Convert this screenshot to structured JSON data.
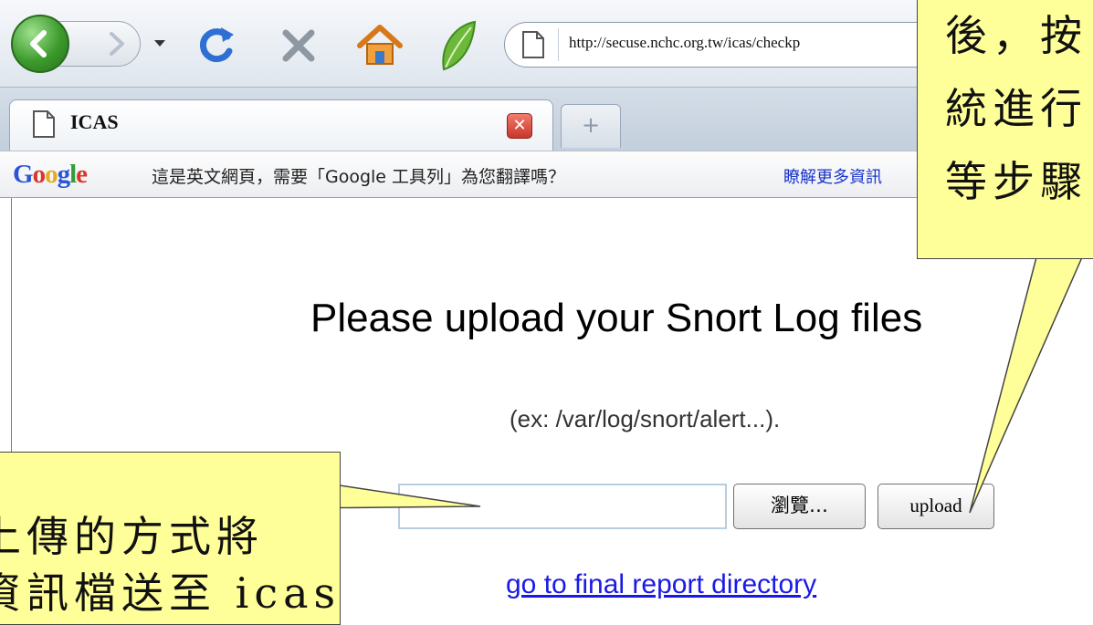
{
  "browser": {
    "url": "http://secuse.nchc.org.tw/icas/checkp",
    "tab_title": "ICAS",
    "tab_close_glyph": "✕",
    "new_tab_glyph": "+"
  },
  "translate_bar": {
    "logo_letters": [
      "G",
      "o",
      "o",
      "g",
      "l",
      "e"
    ],
    "logo_colors": [
      "#2a55d8",
      "#d8382a",
      "#e7a922",
      "#2a55d8",
      "#2f9e3a",
      "#d8382a"
    ],
    "message": "這是英文網頁，需要「Google 工具列」為您翻譯嗎？",
    "learn_more": "瞭解更多資訊"
  },
  "page": {
    "heading": "Please upload your Snort Log files",
    "example": "(ex: /var/log/snort/alert...).",
    "browse_label": "瀏覽…",
    "upload_label": "upload",
    "file_input_value": "",
    "final_report_link": "go to final report directory"
  },
  "callouts": {
    "right": [
      "後，按",
      "統進行",
      "等步驟"
    ],
    "left": [
      "上傳的方式將",
      "資訊檔送至 icas"
    ]
  },
  "colors": {
    "callout_fill": "#ffff99",
    "link": "#1a1ae6",
    "back_button": "#3c9a2c",
    "tab_close": "#c8362a"
  },
  "icons": [
    "back-arrow-icon",
    "forward-arrow-icon",
    "history-dropdown-icon",
    "reload-icon",
    "stop-icon",
    "home-icon",
    "leaf-icon",
    "page-icon",
    "bookmark-star-icon",
    "tab-close-icon",
    "new-tab-icon"
  ]
}
